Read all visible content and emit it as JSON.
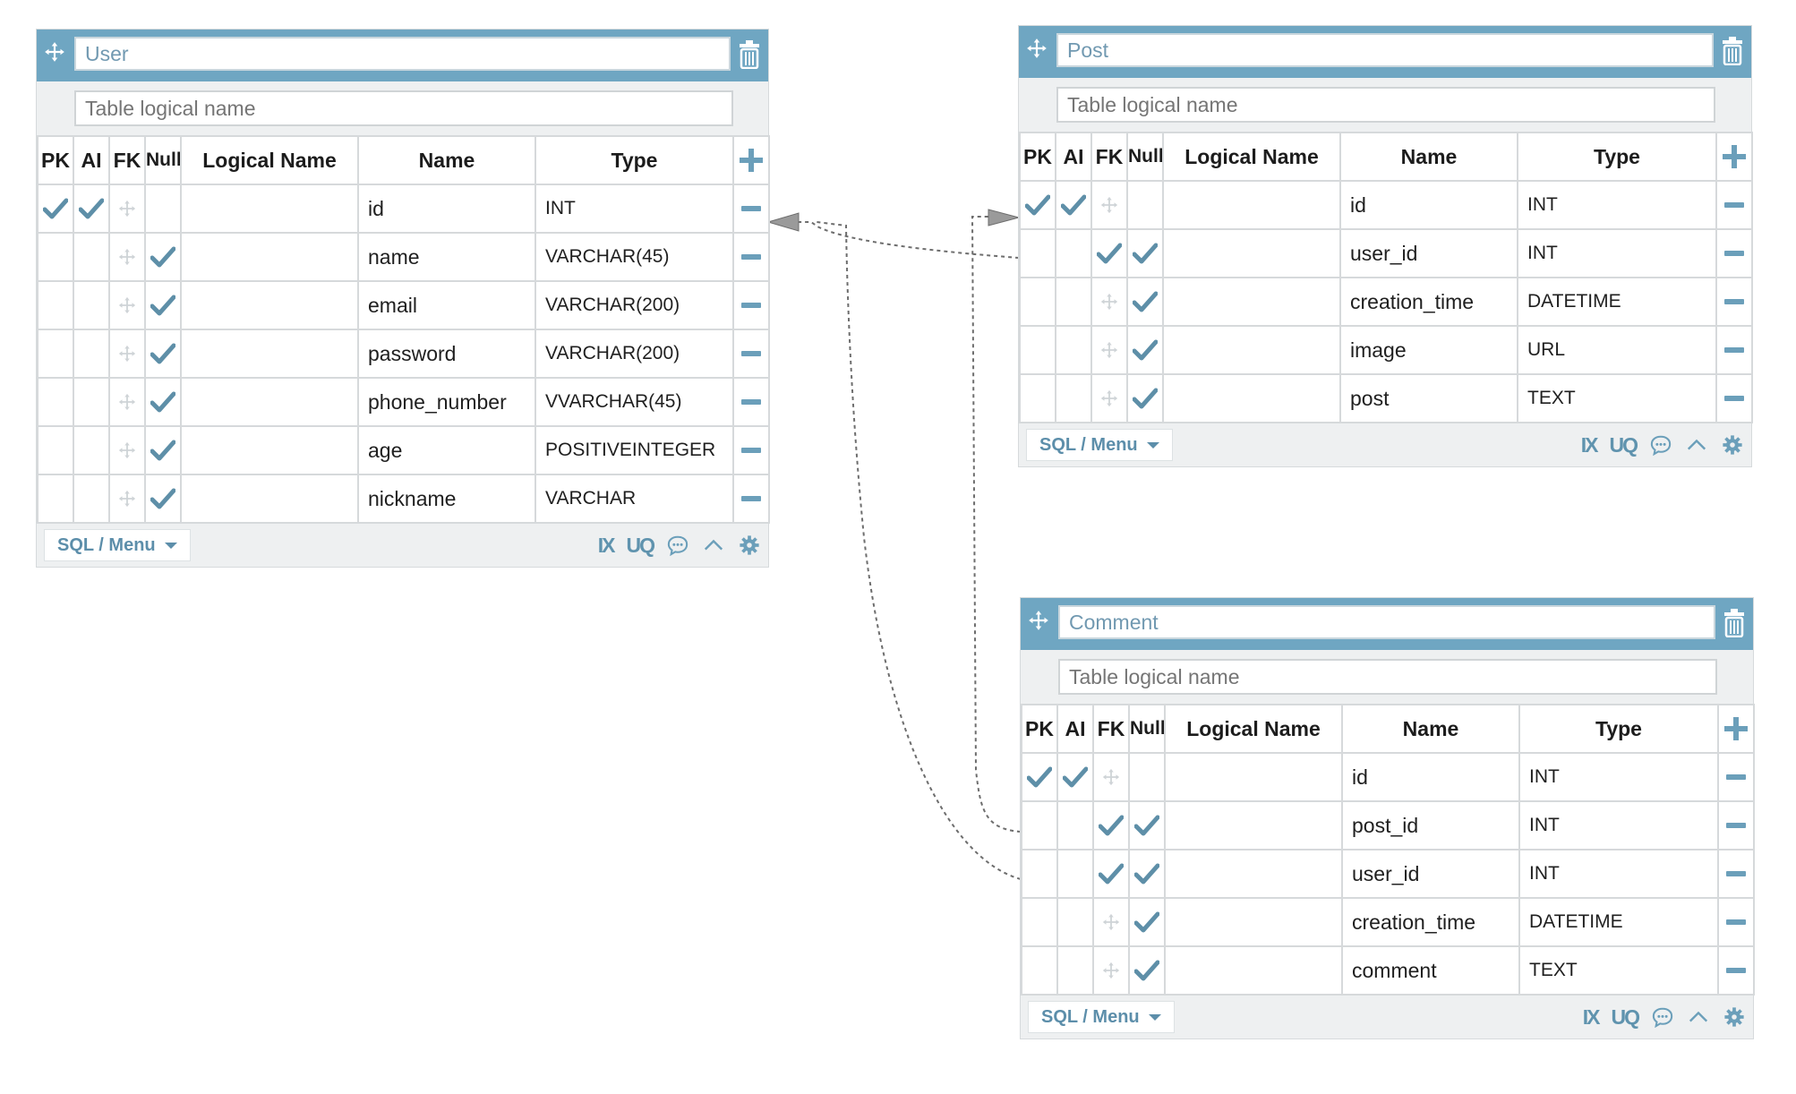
{
  "placeholders": {
    "logical_name": "Table logical name"
  },
  "headers": {
    "pk": "PK",
    "ai": "AI",
    "fk": "FK",
    "null": "Null",
    "logical": "Logical Name",
    "name": "Name",
    "type": "Type"
  },
  "footer": {
    "sql_menu": "SQL / Menu",
    "ix": "IX",
    "uq": "UQ"
  },
  "colors": {
    "accent": "#6fa6c2",
    "check": "#5e8fa8",
    "border": "#d6d9db"
  },
  "tables": {
    "user": {
      "title": "User",
      "columns": [
        {
          "name": "id",
          "type": "INT",
          "pk": true,
          "ai": true,
          "fk": false,
          "null": false
        },
        {
          "name": "name",
          "type": "VARCHAR(45)",
          "pk": false,
          "ai": false,
          "fk": false,
          "null": true
        },
        {
          "name": "email",
          "type": "VARCHAR(200)",
          "pk": false,
          "ai": false,
          "fk": false,
          "null": true
        },
        {
          "name": "password",
          "type": "VARCHAR(200)",
          "pk": false,
          "ai": false,
          "fk": false,
          "null": true
        },
        {
          "name": "phone_number",
          "type": "VVARCHAR(45)",
          "pk": false,
          "ai": false,
          "fk": false,
          "null": true
        },
        {
          "name": "age",
          "type": "POSITIVEINTEGER",
          "pk": false,
          "ai": false,
          "fk": false,
          "null": true
        },
        {
          "name": "nickname",
          "type": "VARCHAR",
          "pk": false,
          "ai": false,
          "fk": false,
          "null": true
        }
      ]
    },
    "post": {
      "title": "Post",
      "columns": [
        {
          "name": "id",
          "type": "INT",
          "pk": true,
          "ai": true,
          "fk": false,
          "null": false
        },
        {
          "name": "user_id",
          "type": "INT",
          "pk": false,
          "ai": false,
          "fk": true,
          "null": true
        },
        {
          "name": "creation_time",
          "type": "DATETIME",
          "pk": false,
          "ai": false,
          "fk": false,
          "null": true
        },
        {
          "name": "image",
          "type": "URL",
          "pk": false,
          "ai": false,
          "fk": false,
          "null": true
        },
        {
          "name": "post",
          "type": "TEXT",
          "pk": false,
          "ai": false,
          "fk": false,
          "null": true
        }
      ]
    },
    "comment": {
      "title": "Comment",
      "columns": [
        {
          "name": "id",
          "type": "INT",
          "pk": true,
          "ai": true,
          "fk": false,
          "null": false
        },
        {
          "name": "post_id",
          "type": "INT",
          "pk": false,
          "ai": false,
          "fk": true,
          "null": true
        },
        {
          "name": "user_id",
          "type": "INT",
          "pk": false,
          "ai": false,
          "fk": true,
          "null": true
        },
        {
          "name": "creation_time",
          "type": "DATETIME",
          "pk": false,
          "ai": false,
          "fk": false,
          "null": true
        },
        {
          "name": "comment",
          "type": "TEXT",
          "pk": false,
          "ai": false,
          "fk": false,
          "null": true
        }
      ]
    }
  }
}
